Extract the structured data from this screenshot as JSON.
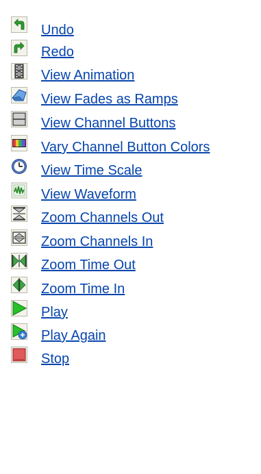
{
  "items": [
    {
      "label": "Undo",
      "icon": "undo-arrow-icon"
    },
    {
      "label": "Redo",
      "icon": "redo-arrow-icon"
    },
    {
      "label": "View Animation",
      "icon": "film-strip-icon"
    },
    {
      "label": "View Fades as Ramps",
      "icon": "ramp-icon"
    },
    {
      "label": "View Channel Buttons",
      "icon": "channel-buttons-icon"
    },
    {
      "label": "Vary Channel Button Colors",
      "icon": "color-bars-icon"
    },
    {
      "label": "View Time Scale",
      "icon": "clock-icon"
    },
    {
      "label": "View Waveform",
      "icon": "waveform-icon"
    },
    {
      "label": "Zoom Channels Out",
      "icon": "zoom-channels-out-icon"
    },
    {
      "label": "Zoom Channels In",
      "icon": "zoom-channels-in-icon"
    },
    {
      "label": "Zoom Time Out",
      "icon": "zoom-time-out-icon"
    },
    {
      "label": "Zoom Time In",
      "icon": "zoom-time-in-icon"
    },
    {
      "label": "Play",
      "icon": "play-icon"
    },
    {
      "label": "Play Again",
      "icon": "play-again-icon"
    },
    {
      "label": "Stop",
      "icon": "stop-icon"
    }
  ],
  "colors": {
    "link": "#0645ad",
    "undo_green": "#2e8b2e",
    "play_green": "#22b422",
    "stop_red": "#e05050"
  }
}
